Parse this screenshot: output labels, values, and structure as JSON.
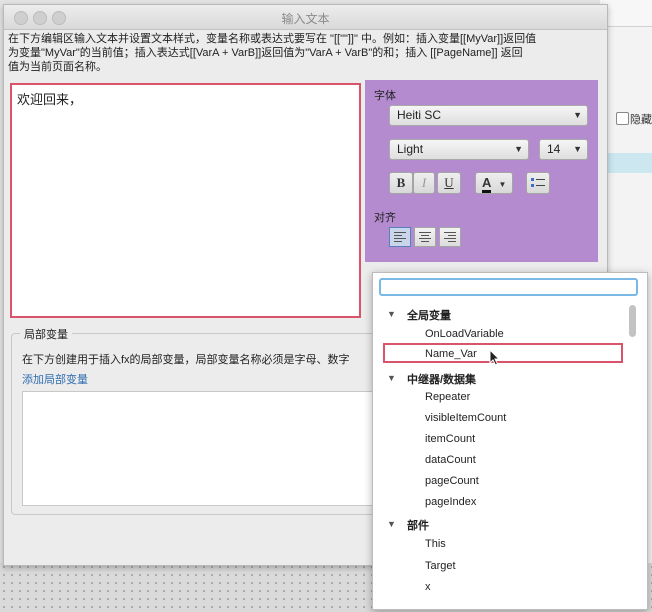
{
  "dialog": {
    "title": "输入文本",
    "description_lines": [
      "在下方编辑区输入文本并设置文本样式，变量名称或表达式要写在 \"[[\"\"]]\" 中。例如：插入变量[[MyVar]]返回值",
      "为变量\"MyVar\"的当前值；插入表达式[[VarA + VarB]]返回值为\"VarA + VarB\"的和；插入 [[PageName]] 返回",
      "值为当前页面名称。"
    ],
    "editor_text": "欢迎回来，"
  },
  "style_panel": {
    "font_label": "字体",
    "font_family": "Heiti SC",
    "font_weight": "Light",
    "font_size": "14",
    "bold_label": "B",
    "italic_label": "I",
    "underline_label": "U",
    "color_label": "A",
    "align_label": "对齐"
  },
  "local_vars": {
    "group_title": "局部变量",
    "description": "在下方创建用于插入fx的局部变量，局部变量名称必须是字母、数字",
    "add_link": "添加局部变量"
  },
  "variable_tree": {
    "search_value": "",
    "groups": [
      {
        "label": "全局变量",
        "items": [
          "OnLoadVariable",
          "Name_Var"
        ]
      },
      {
        "label": "中继器/数据集",
        "items": [
          "Repeater",
          "visibleItemCount",
          "itemCount",
          "dataCount",
          "pageCount",
          "pageIndex"
        ]
      },
      {
        "label": "部件",
        "items": [
          "This",
          "Target",
          "x"
        ]
      }
    ],
    "selected_item": "Name_Var"
  },
  "background_app": {
    "checkbox_label": "隐藏"
  },
  "colors": {
    "accent_highlight": "#d9546a",
    "style_panel_bg": "#b58bd0",
    "link": "#2f6db0",
    "search_focus": "#7ab9e6"
  }
}
